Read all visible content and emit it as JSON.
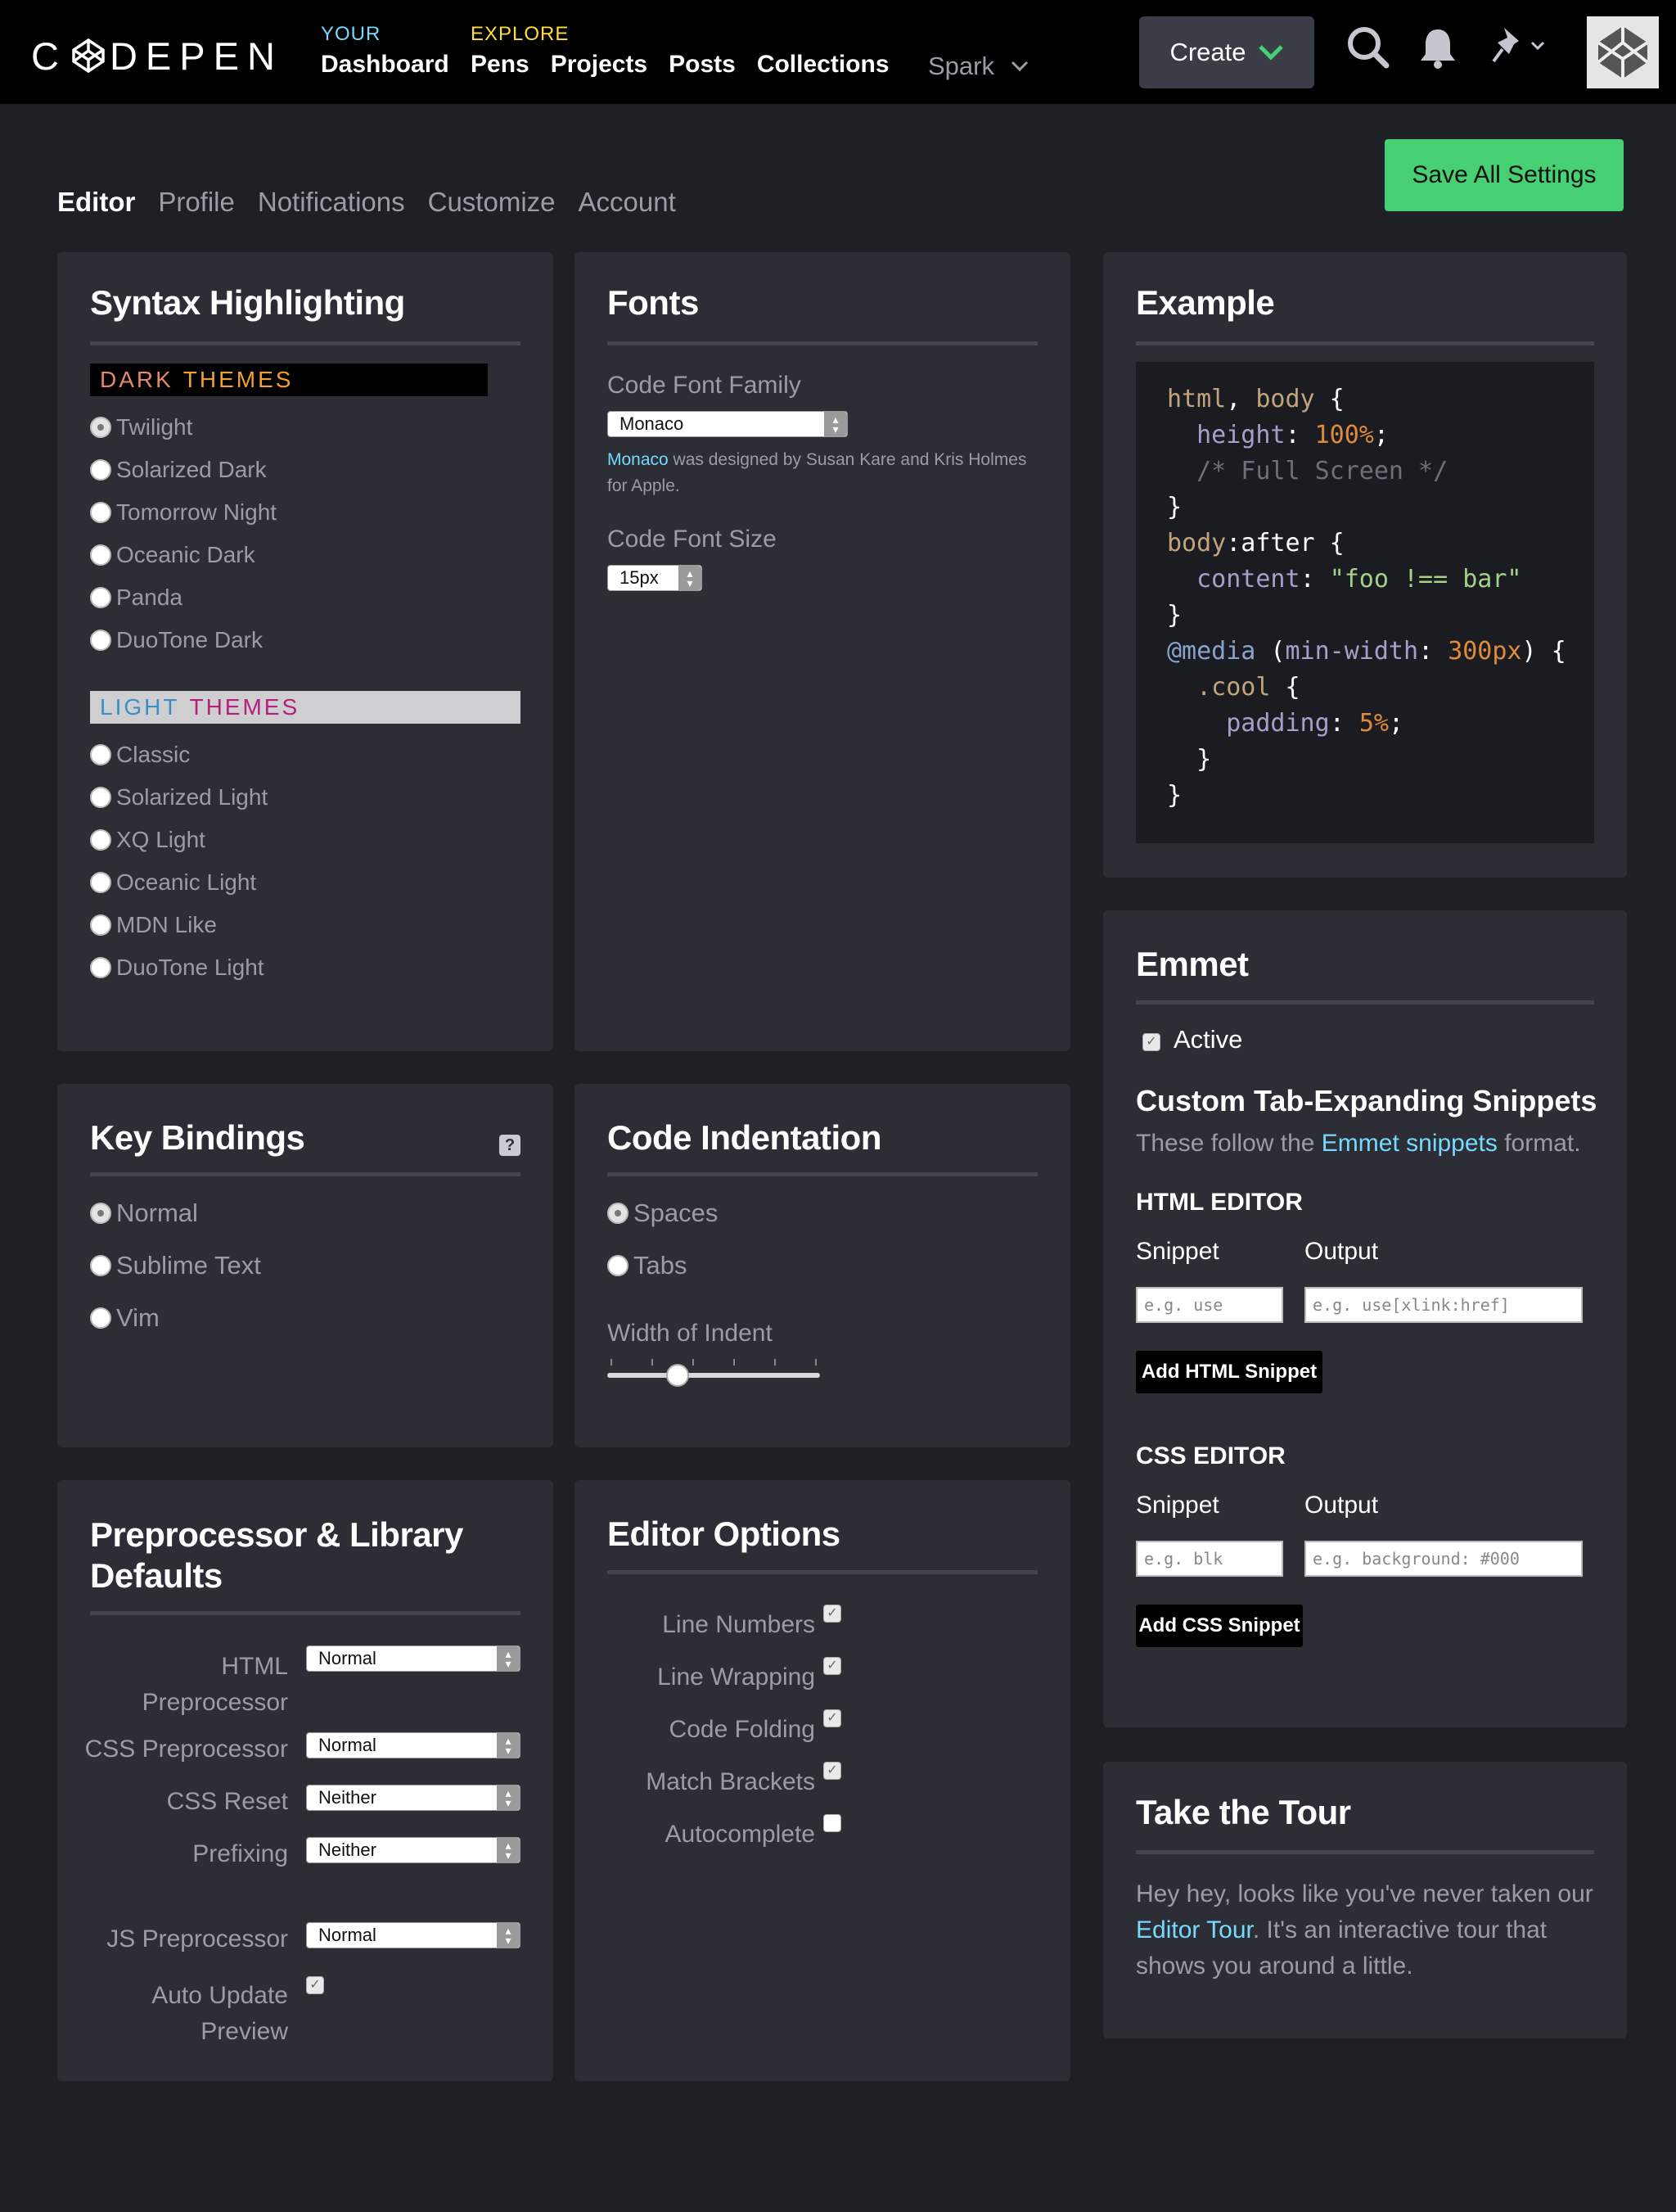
{
  "brand": {
    "logo_text": "CODEPEN"
  },
  "nav": {
    "your_label": "YOUR",
    "your_links": [
      "Dashboard"
    ],
    "explore_label": "EXPLORE",
    "explore_links": [
      "Pens",
      "Projects",
      "Posts",
      "Collections"
    ],
    "spark": "Spark",
    "create": "Create"
  },
  "settings_tabs": [
    "Editor",
    "Profile",
    "Notifications",
    "Customize",
    "Account"
  ],
  "save_all": "Save All Settings",
  "syntax": {
    "title": "Syntax Highlighting",
    "dark_label_1": "DARK",
    "dark_label_2": "THEMES",
    "dark_themes": [
      "Twilight",
      "Solarized Dark",
      "Tomorrow Night",
      "Oceanic Dark",
      "Panda",
      "DuoTone Dark"
    ],
    "light_label_1": "LIGHT",
    "light_label_2": "THEMES",
    "light_themes": [
      "Classic",
      "Solarized Light",
      "XQ Light",
      "Oceanic Light",
      "MDN Like",
      "DuoTone Light"
    ],
    "selected": "Twilight"
  },
  "fonts": {
    "title": "Fonts",
    "family_label": "Code Font Family",
    "family_value": "Monaco",
    "credit_link": "Monaco",
    "credit_text_1": " was designed by Susan Kare and Kris Holmes",
    "credit_text_2": "for Apple.",
    "size_label": "Code Font Size",
    "size_value": "15px"
  },
  "example": {
    "title": "Example"
  },
  "keybindings": {
    "title": "Key Bindings",
    "help": "?",
    "options": [
      "Normal",
      "Sublime Text",
      "Vim"
    ],
    "selected": "Normal"
  },
  "indentation": {
    "title": "Code Indentation",
    "options": [
      "Spaces",
      "Tabs"
    ],
    "selected": "Spaces",
    "width_label": "Width of Indent",
    "width_level": 0.33
  },
  "preprocessor": {
    "title_1": "Preprocessor & Library",
    "title_2": "Defaults",
    "html_label_1": "HTML",
    "html_label_2": "Preprocessor",
    "html_value": "Normal",
    "css_label": "CSS Preprocessor",
    "css_value": "Normal",
    "reset_label": "CSS Reset",
    "reset_value": "Neither",
    "prefix_label": "Prefixing",
    "prefix_value": "Neither",
    "js_label": "JS Preprocessor",
    "js_value": "Normal",
    "auto_label_1": "Auto Update",
    "auto_label_2": "Preview",
    "auto_checked": true
  },
  "editor_options": {
    "title": "Editor Options",
    "items": [
      {
        "label": "Line Numbers",
        "checked": true
      },
      {
        "label": "Line Wrapping",
        "checked": true
      },
      {
        "label": "Code Folding",
        "checked": true
      },
      {
        "label": "Match Brackets",
        "checked": true
      },
      {
        "label": "Autocomplete",
        "checked": false
      }
    ]
  },
  "emmet": {
    "title": "Emmet",
    "active_label": "Active",
    "active_checked": true,
    "custom_title": "Custom Tab-Expanding Snippets",
    "follow_1": "These follow the ",
    "follow_link": "Emmet snippets",
    "follow_2": " format.",
    "html_heading": "HTML EDITOR",
    "snippet_label": "Snippet",
    "output_label": "Output",
    "html_snippet_ph": "e.g. use",
    "html_output_ph": "e.g. use[xlink:href]",
    "add_html": "Add HTML Snippet",
    "css_heading": "CSS EDITOR",
    "css_snippet_ph": "e.g. blk",
    "css_output_ph": "e.g. background: #000",
    "add_css": "Add CSS Snippet"
  },
  "tour": {
    "title": "Take the Tour",
    "text_1": "Hey hey, looks like you've never taken our",
    "link": "Editor Tour",
    "text_2": ". It's an interactive tour that",
    "text_3": "shows you around a little."
  }
}
